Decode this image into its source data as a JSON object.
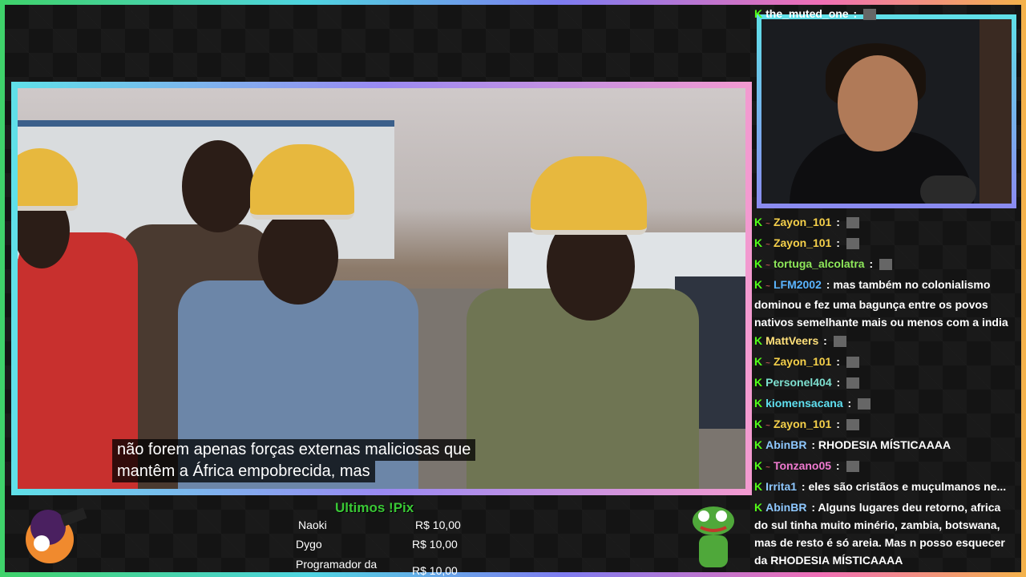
{
  "video": {
    "subtitle_line1": "não forem apenas forças externas maliciosas que",
    "subtitle_line2": "mantêm a África empobrecida, mas"
  },
  "chat": [
    {
      "user": "the_muted_one",
      "color": "#ffffff",
      "badge": "",
      "text": ""
    },
    {
      "user": "Zayon_101",
      "color": "#f5d04a",
      "badge": "~",
      "text": ""
    },
    {
      "user": "Zayon_101",
      "color": "#f5d04a",
      "badge": "~",
      "text": ""
    },
    {
      "user": "tortuga_alcolatra",
      "color": "#8ee85a",
      "badge": "~",
      "text": ""
    },
    {
      "user": "LFM2002",
      "color": "#5ab4ff",
      "badge": "~",
      "text": "mas também no colonialismo dominou e fez uma bagunça entre os povos nativos semelhante mais ou menos com a india"
    },
    {
      "user": "MattVeers",
      "color": "#ffe07a",
      "badge": "",
      "text": ""
    },
    {
      "user": "Zayon_101",
      "color": "#f5d04a",
      "badge": "~",
      "text": ""
    },
    {
      "user": "Personel404",
      "color": "#7ee0d0",
      "badge": "",
      "text": ""
    },
    {
      "user": "kiomensacana",
      "color": "#5fe0f0",
      "badge": "",
      "text": ""
    },
    {
      "user": "Zayon_101",
      "color": "#f5d04a",
      "badge": "~",
      "text": ""
    },
    {
      "user": "AbinBR",
      "color": "#8ec8ff",
      "badge": "",
      "text": "RHODESIA MÍSTICAAAA"
    },
    {
      "user": "Tonzano05",
      "color": "#f07ad0",
      "badge": "~",
      "text": ""
    },
    {
      "user": "Irrita1",
      "color": "#8ec8ff",
      "badge": "",
      "text": "eles são cristãos e muçulmanos ne..."
    },
    {
      "user": "AbinBR",
      "color": "#8ec8ff",
      "badge": "",
      "text": "Alguns lugares deu retorno, africa do sul tinha muito minério, zambia, botswana, mas de resto é só areia. Mas n posso esquecer da RHODESIA MÍSTICAAAA"
    }
  ],
  "pix": {
    "title": "Ultimos !Pix",
    "entries": [
      {
        "name": "Naoki",
        "value": "R$ 10,00"
      },
      {
        "name": "Dygo",
        "value": "R$ 10,00"
      },
      {
        "name": "Programador da",
        "value": "R$ 10,00"
      }
    ]
  },
  "icons": {
    "chat_badge": "kick-icon"
  }
}
